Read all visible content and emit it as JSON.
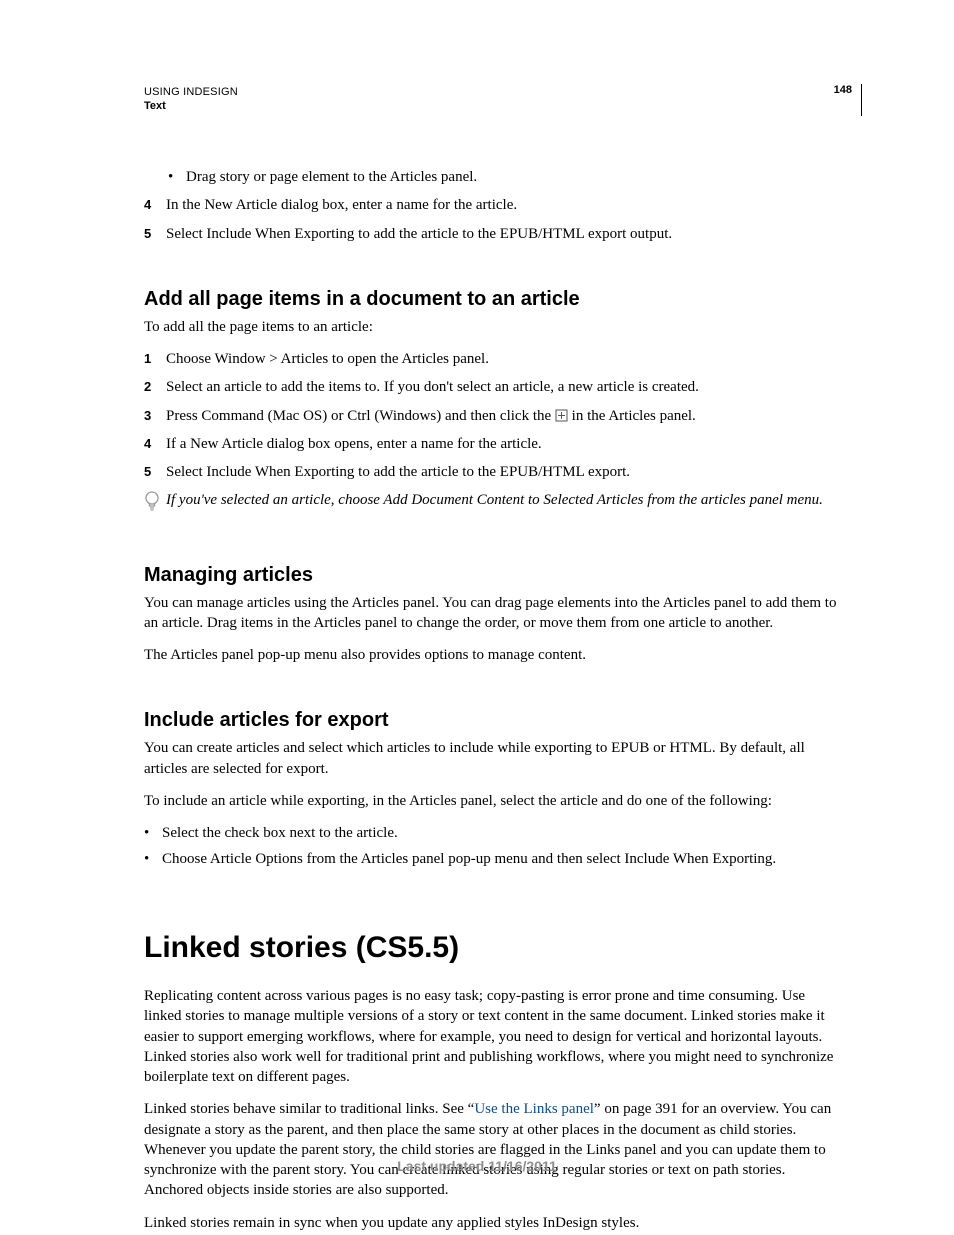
{
  "header": {
    "running_title": "USING INDESIGN",
    "section": "Text",
    "page_number": "148"
  },
  "top_list": {
    "bullet1": "Drag story or page element to the Articles panel.",
    "n4": "4",
    "item4": "In the New Article dialog box, enter a name for the article.",
    "n5": "5",
    "item5": "Select Include When Exporting to add the article to the EPUB/HTML export output."
  },
  "sec1": {
    "heading": "Add all page items in a document to an article",
    "intro": "To add all the page items to an article:",
    "n1": "1",
    "i1": "Choose Window > Articles to open the Articles panel.",
    "n2": "2",
    "i2": "Select an article to add the items to. If you don't select an article, a new article is created.",
    "n3": "3",
    "i3a": "Press Command (Mac OS) or Ctrl (Windows) and then click the ",
    "i3b": " in the Articles panel.",
    "n4": "4",
    "i4": "If a New Article dialog box opens, enter a name for the article.",
    "n5": "5",
    "i5": "Select Include When Exporting to add the article to the EPUB/HTML export.",
    "tip": "If you've selected an article, choose Add Document Content to Selected Articles from the articles panel menu."
  },
  "sec2": {
    "heading": "Managing articles",
    "p1": "You can manage articles using the Articles panel. You can drag page elements into the Articles panel to add them to an article. Drag items in the Articles panel to change the order, or move them from one article to another.",
    "p2": "The Articles panel pop-up menu also provides options to manage content."
  },
  "sec3": {
    "heading": "Include articles for export",
    "p1": "You can create articles and select which articles to include while exporting to EPUB or HTML. By default, all articles are selected for export.",
    "p2": "To include an article while exporting, in the Articles panel, select the article and do one of the following:",
    "b1": "Select the check box next to the article.",
    "b2": "Choose Article Options from the Articles panel pop-up menu and then select Include When Exporting."
  },
  "chapter": {
    "heading": "Linked stories (CS5.5)",
    "p1": "Replicating content across various pages is no easy task; copy-pasting is error prone and time consuming. Use linked stories to manage multiple versions of a story or text content in the same document. Linked stories make it easier to support emerging workflows, where for example, you need to design for vertical and horizontal layouts. Linked stories also work well for traditional print and publishing workflows, where you might need to synchronize boilerplate text on different pages.",
    "p2a": "Linked stories behave similar to traditional links. See “",
    "p2link": "Use the Links panel",
    "p2b": "” on page 391 for an overview. You can designate a story as the parent, and then place the same story at other places in the document as child stories. Whenever you update the parent story, the child stories are flagged in the Links panel and you can update them to synchronize with the parent story. You can create linked stories using regular stories or text on path stories. Anchored objects inside stories are also supported.",
    "p3": "Linked stories remain in sync when you update any applied styles InDesign styles."
  },
  "footer": "Last updated 11/16/2011"
}
